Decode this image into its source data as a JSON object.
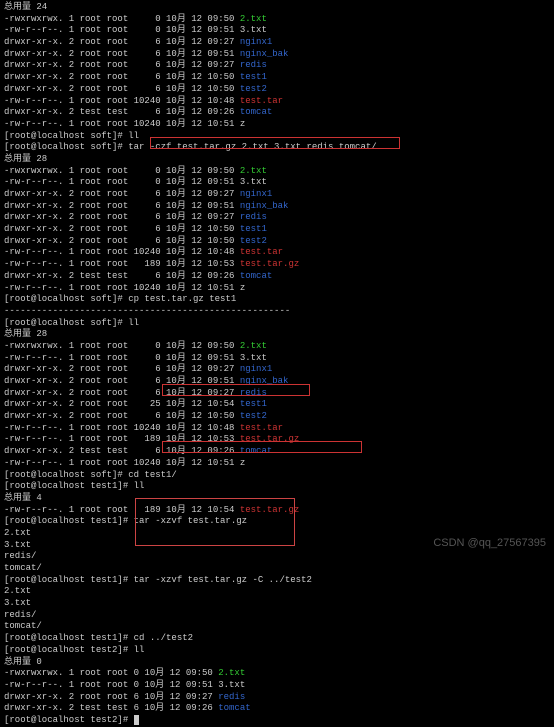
{
  "total_label": "总用量",
  "sections": {
    "s1": {
      "total": "24",
      "lines": [
        {
          "perm": "-rwxrwxrwx.",
          "n": "1",
          "o": "root",
          "g": "root",
          "sz": "    0",
          "d": "10月 12 09:50",
          "name": "2.txt",
          "cls": "green"
        },
        {
          "perm": "-rw-r--r--.",
          "n": "1",
          "o": "root",
          "g": "root",
          "sz": "    0",
          "d": "10月 12 09:51",
          "name": "3.txt",
          "cls": ""
        },
        {
          "perm": "drwxr-xr-x.",
          "n": "2",
          "o": "root",
          "g": "root",
          "sz": "    6",
          "d": "10月 12 09:27",
          "name": "nginx1",
          "cls": "blue"
        },
        {
          "perm": "drwxr-xr-x.",
          "n": "2",
          "o": "root",
          "g": "root",
          "sz": "    6",
          "d": "10月 12 09:51",
          "name": "nginx_bak",
          "cls": "blue"
        },
        {
          "perm": "drwxr-xr-x.",
          "n": "2",
          "o": "root",
          "g": "root",
          "sz": "    6",
          "d": "10月 12 09:27",
          "name": "redis",
          "cls": "blue"
        },
        {
          "perm": "drwxr-xr-x.",
          "n": "2",
          "o": "root",
          "g": "root",
          "sz": "    6",
          "d": "10月 12 10:50",
          "name": "test1",
          "cls": "blue"
        },
        {
          "perm": "drwxr-xr-x.",
          "n": "2",
          "o": "root",
          "g": "root",
          "sz": "    6",
          "d": "10月 12 10:50",
          "name": "test2",
          "cls": "blue"
        },
        {
          "perm": "-rw-r--r--.",
          "n": "1",
          "o": "root",
          "g": "root",
          "sz": "10240",
          "d": "10月 12 10:48",
          "name": "test.tar",
          "cls": "red"
        },
        {
          "perm": "drwxr-xr-x.",
          "n": "2",
          "o": "test",
          "g": "test",
          "sz": "    6",
          "d": "10月 12 09:26",
          "name": "tomcat",
          "cls": "blue"
        },
        {
          "perm": "-rw-r--r--.",
          "n": "1",
          "o": "root",
          "g": "root",
          "sz": "10240",
          "d": "10月 12 10:51",
          "name": "z",
          "cls": ""
        }
      ]
    },
    "prompt1": {
      "host": "[root@localhost soft]#",
      "cmd": "ll"
    },
    "prompt_tar": {
      "host": "[root@localhost soft]#",
      "cmd": "tar -czf test.tar.gz 2.txt 3.txt redis tomcat/"
    },
    "s2": {
      "total": "28",
      "lines": [
        {
          "perm": "-rwxrwxrwx.",
          "n": "1",
          "o": "root",
          "g": "root",
          "sz": "    0",
          "d": "10月 12 09:50",
          "name": "2.txt",
          "cls": "green"
        },
        {
          "perm": "-rw-r--r--.",
          "n": "1",
          "o": "root",
          "g": "root",
          "sz": "    0",
          "d": "10月 12 09:51",
          "name": "3.txt",
          "cls": ""
        },
        {
          "perm": "drwxr-xr-x.",
          "n": "2",
          "o": "root",
          "g": "root",
          "sz": "    6",
          "d": "10月 12 09:27",
          "name": "nginx1",
          "cls": "blue"
        },
        {
          "perm": "drwxr-xr-x.",
          "n": "2",
          "o": "root",
          "g": "root",
          "sz": "    6",
          "d": "10月 12 09:51",
          "name": "nginx_bak",
          "cls": "blue"
        },
        {
          "perm": "drwxr-xr-x.",
          "n": "2",
          "o": "root",
          "g": "root",
          "sz": "    6",
          "d": "10月 12 09:27",
          "name": "redis",
          "cls": "blue"
        },
        {
          "perm": "drwxr-xr-x.",
          "n": "2",
          "o": "root",
          "g": "root",
          "sz": "    6",
          "d": "10月 12 10:50",
          "name": "test1",
          "cls": "blue"
        },
        {
          "perm": "drwxr-xr-x.",
          "n": "2",
          "o": "root",
          "g": "root",
          "sz": "    6",
          "d": "10月 12 10:50",
          "name": "test2",
          "cls": "blue"
        },
        {
          "perm": "-rw-r--r--.",
          "n": "1",
          "o": "root",
          "g": "root",
          "sz": "10240",
          "d": "10月 12 10:48",
          "name": "test.tar",
          "cls": "red"
        },
        {
          "perm": "-rw-r--r--.",
          "n": "1",
          "o": "root",
          "g": "root",
          "sz": "  189",
          "d": "10月 12 10:53",
          "name": "test.tar.gz",
          "cls": "red"
        },
        {
          "perm": "drwxr-xr-x.",
          "n": "2",
          "o": "test",
          "g": "test",
          "sz": "    6",
          "d": "10月 12 09:26",
          "name": "tomcat",
          "cls": "blue"
        },
        {
          "perm": "-rw-r--r--.",
          "n": "1",
          "o": "root",
          "g": "root",
          "sz": "10240",
          "d": "10月 12 10:51",
          "name": "z",
          "cls": ""
        }
      ]
    },
    "cp": {
      "host": "[root@localhost soft]#",
      "cmd": "cp test.tar.gz test1"
    },
    "hr": "-----------------------------------------------------",
    "ll2": {
      "host": "[root@localhost soft]#",
      "cmd": "ll"
    },
    "s3": {
      "total": "28",
      "lines": [
        {
          "perm": "-rwxrwxrwx.",
          "n": "1",
          "o": "root",
          "g": "root",
          "sz": "    0",
          "d": "10月 12 09:50",
          "name": "2.txt",
          "cls": "green"
        },
        {
          "perm": "-rw-r--r--.",
          "n": "1",
          "o": "root",
          "g": "root",
          "sz": "    0",
          "d": "10月 12 09:51",
          "name": "3.txt",
          "cls": ""
        },
        {
          "perm": "drwxr-xr-x.",
          "n": "2",
          "o": "root",
          "g": "root",
          "sz": "    6",
          "d": "10月 12 09:27",
          "name": "nginx1",
          "cls": "blue"
        },
        {
          "perm": "drwxr-xr-x.",
          "n": "2",
          "o": "root",
          "g": "root",
          "sz": "    6",
          "d": "10月 12 09:51",
          "name": "nginx_bak",
          "cls": "blue"
        },
        {
          "perm": "drwxr-xr-x.",
          "n": "2",
          "o": "root",
          "g": "root",
          "sz": "    6",
          "d": "10月 12 09:27",
          "name": "redis",
          "cls": "blue"
        },
        {
          "perm": "drwxr-xr-x.",
          "n": "2",
          "o": "root",
          "g": "root",
          "sz": "   25",
          "d": "10月 12 10:54",
          "name": "test1",
          "cls": "blue"
        },
        {
          "perm": "drwxr-xr-x.",
          "n": "2",
          "o": "root",
          "g": "root",
          "sz": "    6",
          "d": "10月 12 10:50",
          "name": "test2",
          "cls": "blue"
        },
        {
          "perm": "-rw-r--r--.",
          "n": "1",
          "o": "root",
          "g": "root",
          "sz": "10240",
          "d": "10月 12 10:48",
          "name": "test.tar",
          "cls": "red"
        },
        {
          "perm": "-rw-r--r--.",
          "n": "1",
          "o": "root",
          "g": "root",
          "sz": "  189",
          "d": "10月 12 10:53",
          "name": "test.tar.gz",
          "cls": "red"
        },
        {
          "perm": "drwxr-xr-x.",
          "n": "2",
          "o": "test",
          "g": "test",
          "sz": "    6",
          "d": "10月 12 09:26",
          "name": "tomcat",
          "cls": "blue"
        },
        {
          "perm": "-rw-r--r--.",
          "n": "1",
          "o": "root",
          "g": "root",
          "sz": "10240",
          "d": "10月 12 10:51",
          "name": "z",
          "cls": ""
        }
      ]
    },
    "cd": {
      "host": "[root@localhost soft]#",
      "cmd": "cd test1/"
    },
    "ll3": {
      "host": "[root@localhost test1]#",
      "cmd": "ll"
    },
    "s4": {
      "total": "4",
      "lines": [
        {
          "perm": "-rw-r--r--.",
          "n": "1",
          "o": "root",
          "g": "root",
          "sz": "  189",
          "d": "10月 12 10:54",
          "name": "test.tar.gz",
          "cls": "red"
        }
      ]
    },
    "xzvf": {
      "host": "[root@localhost test1]#",
      "cmd": "tar -xzvf test.tar.gz"
    },
    "out1": [
      "2.txt",
      "3.txt",
      "redis/",
      "tomcat/"
    ],
    "xzvf2": {
      "host": "[root@localhost test1]#",
      "cmd": "tar -xzvf test.tar.gz -C ../test2"
    },
    "out2": [
      "2.txt",
      "3.txt",
      "redis/",
      "tomcat/"
    ],
    "cd2": {
      "host": "[root@localhost test1]#",
      "cmd": "cd ../test2"
    },
    "ll4": {
      "host": "[root@localhost test2]#",
      "cmd": "ll"
    },
    "s5": {
      "total": "0",
      "lines": [
        {
          "perm": "-rwxrwxrwx.",
          "n": "1",
          "o": "root",
          "g": "root",
          "sz": "0",
          "d": "10月 12 09:50",
          "name": "2.txt",
          "cls": "green"
        },
        {
          "perm": "-rw-r--r--.",
          "n": "1",
          "o": "root",
          "g": "root",
          "sz": "0",
          "d": "10月 12 09:51",
          "name": "3.txt",
          "cls": ""
        },
        {
          "perm": "drwxr-xr-x.",
          "n": "2",
          "o": "root",
          "g": "root",
          "sz": "6",
          "d": "10月 12 09:27",
          "name": "redis",
          "cls": "blue"
        },
        {
          "perm": "drwxr-xr-x.",
          "n": "2",
          "o": "test",
          "g": "test",
          "sz": "6",
          "d": "10月 12 09:26",
          "name": "tomcat",
          "cls": "blue"
        }
      ]
    },
    "final": {
      "host": "[root@localhost test2]#",
      "cmd": ""
    }
  },
  "watermark": "CSDN @qq_27567395"
}
